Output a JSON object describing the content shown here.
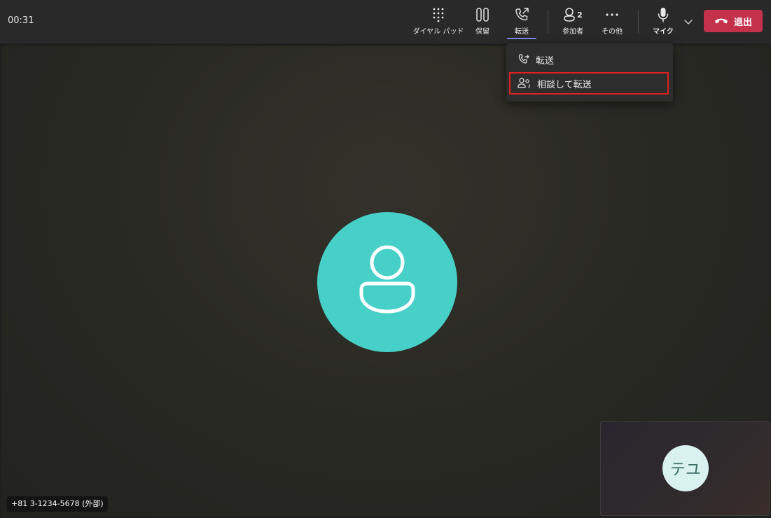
{
  "call": {
    "timer": "00:31",
    "caller_label": "+81 3-1234-5678 (外部)",
    "self_initials": "テユ"
  },
  "toolbar": {
    "dialpad_label": "ダイヤル パッド",
    "hold_label": "保留",
    "transfer_label": "転送",
    "participants_label": "参加者",
    "participants_count": "2",
    "more_label": "その他",
    "mic_label": "マイク",
    "leave_label": "退出"
  },
  "transfer_menu": {
    "items": [
      {
        "label": "転送",
        "icon": "call-transfer-icon"
      },
      {
        "label": "相談して転送",
        "icon": "consult-transfer-icon"
      }
    ]
  },
  "colors": {
    "accent": "#7f85f5",
    "leave": "#c4314b",
    "avatar": "#47d0c8",
    "highlight": "#e02020"
  }
}
